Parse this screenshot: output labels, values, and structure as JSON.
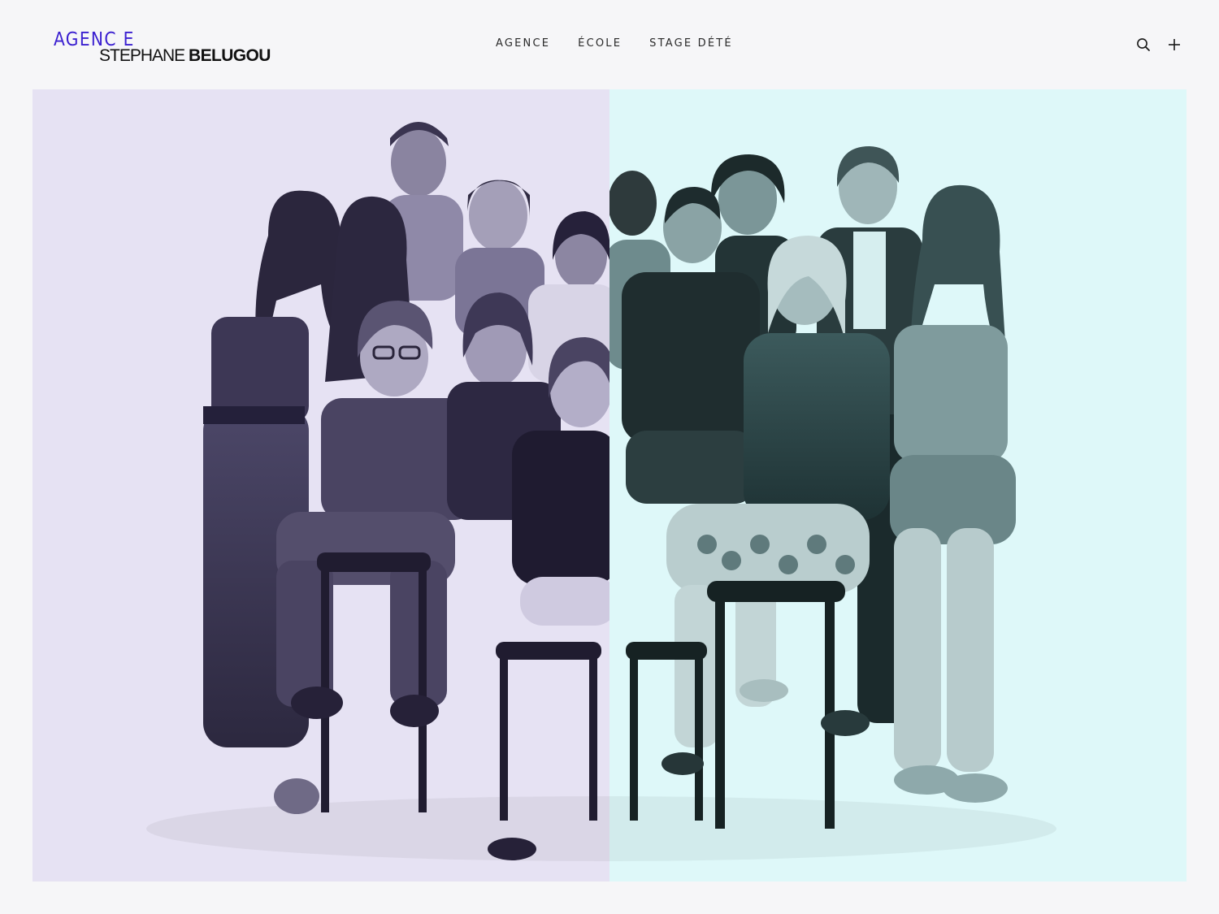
{
  "brand": {
    "line1": "AGENC E",
    "line2_regular": "STEPHANE",
    "line2_bold": "BELUGOU",
    "accent_color": "#3a1fd0"
  },
  "nav": {
    "items": [
      {
        "label": "AGENCE"
      },
      {
        "label": "ÉCOLE"
      },
      {
        "label": "STAGE DÉTÉ"
      }
    ]
  },
  "icons": {
    "search": "search-icon",
    "plus": "plus-icon"
  },
  "hero": {
    "image": "group-photo",
    "left_tint": "#e6e2f3",
    "right_tint": "#def8f9"
  }
}
